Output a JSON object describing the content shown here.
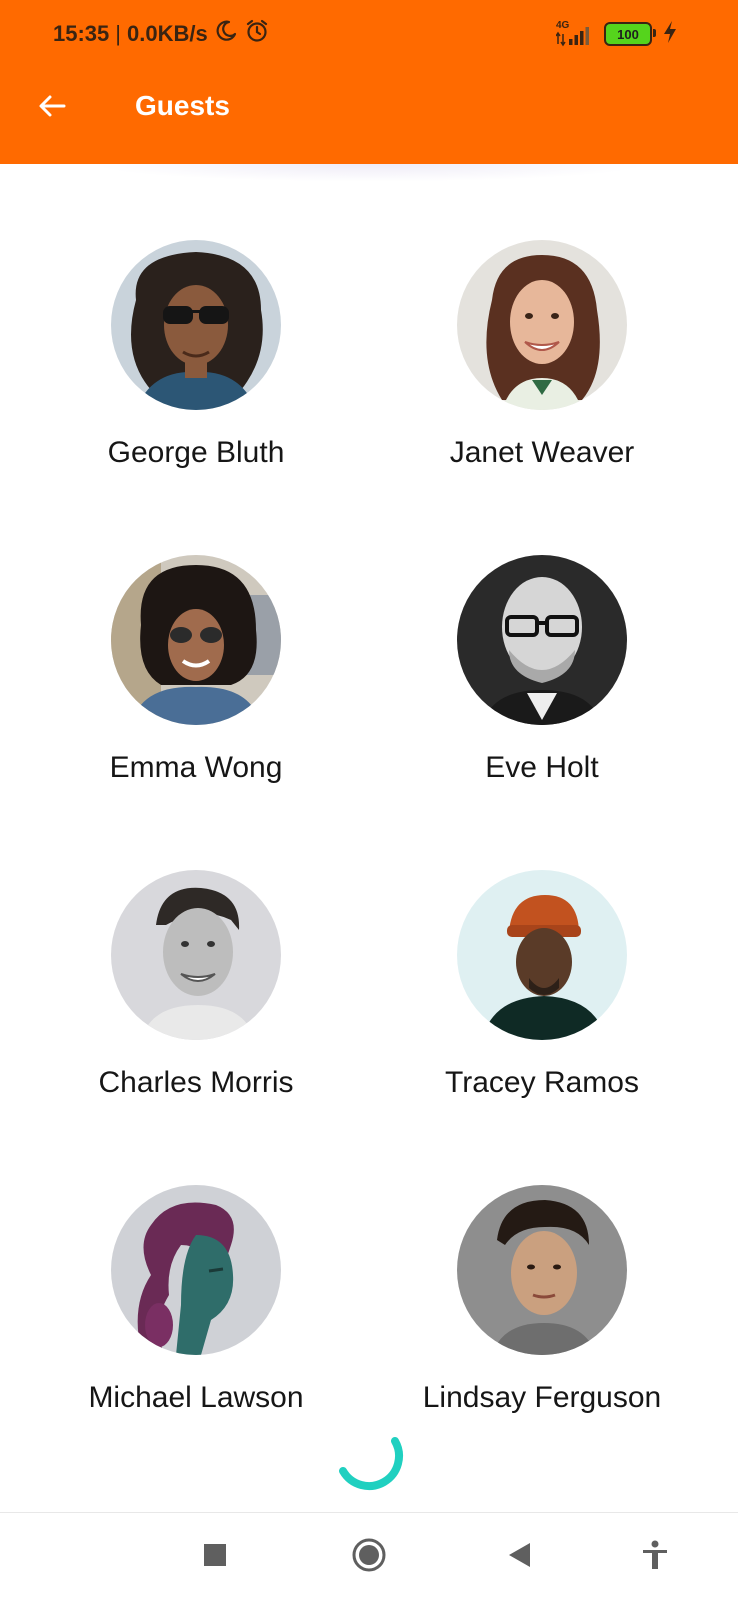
{
  "status_bar": {
    "time": "15:35",
    "separator": "|",
    "net_speed": "0.0KB/s",
    "network": "4G",
    "battery": "100"
  },
  "app_bar": {
    "title": "Guests"
  },
  "guests": [
    {
      "name": "George Bluth"
    },
    {
      "name": "Janet Weaver"
    },
    {
      "name": "Emma Wong"
    },
    {
      "name": "Eve Holt"
    },
    {
      "name": "Charles Morris"
    },
    {
      "name": "Tracey Ramos"
    },
    {
      "name": "Michael Lawson"
    },
    {
      "name": "Lindsay Ferguson"
    }
  ],
  "colors": {
    "primary": "#ff6a00",
    "spinner": "#20d0c0",
    "nav_icon": "#5f5f5f"
  },
  "icons": {
    "back": "arrow-left-icon",
    "moon": "moon-icon",
    "alarm": "alarm-clock-icon",
    "signal": "signal-icon",
    "battery": "battery-icon",
    "charging": "lightning-icon",
    "nav_recents": "stop-square-icon",
    "nav_home": "home-circle-icon",
    "nav_back": "back-triangle-icon",
    "nav_accessibility": "accessibility-icon"
  }
}
